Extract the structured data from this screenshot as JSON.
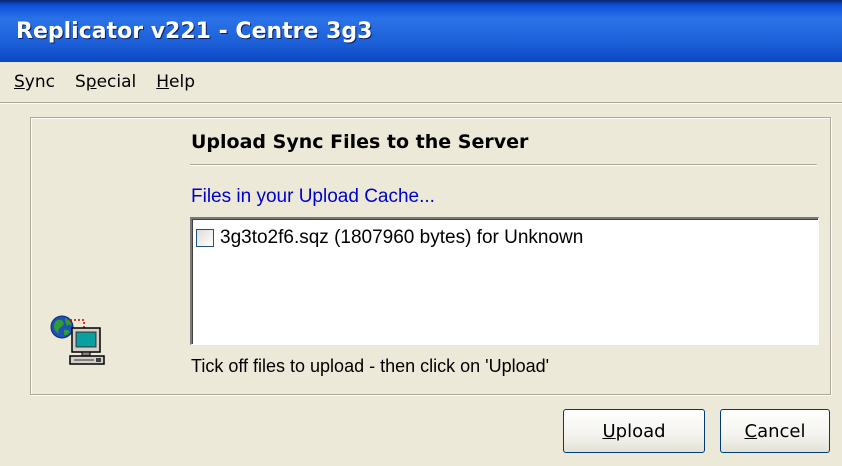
{
  "window": {
    "title": "Replicator v221 - Centre 3g3"
  },
  "menu": {
    "items": [
      {
        "label": "Sync",
        "accel": "S",
        "rest": "ync"
      },
      {
        "label": "Special",
        "accel_prefix": "S",
        "accel": "p",
        "rest": "ecial"
      },
      {
        "label": "Help",
        "accel": "H",
        "rest": "elp"
      }
    ]
  },
  "main": {
    "heading": "Upload Sync Files to the Server",
    "cache_label": "Files in your Upload Cache...",
    "files": [
      {
        "label": "3g3to2f6.sqz (1807960 bytes) for Unknown",
        "checked": false
      }
    ],
    "hint": "Tick off files to upload - then click on 'Upload'",
    "icon": "network-computer-icon"
  },
  "buttons": {
    "upload": {
      "label": "Upload",
      "accel": "U",
      "rest": "pload"
    },
    "cancel": {
      "label": "Cancel",
      "accel": "C",
      "rest": "ancel"
    }
  }
}
